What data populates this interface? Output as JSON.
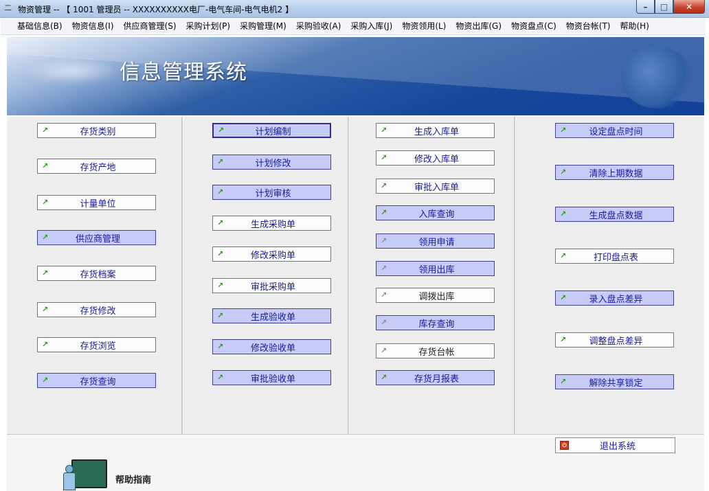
{
  "window": {
    "title": "物资管理 -- 【 1001 管理员 -- XXXXXXXXXX电厂-电气车间-电气电机2 】",
    "app_icon": "二",
    "controls": {
      "min": "–",
      "max": "□",
      "close": "✕"
    }
  },
  "menu": [
    "基础信息(B)",
    "物资信息(I)",
    "供应商管理(S)",
    "采购计划(P)",
    "采购管理(M)",
    "采购验收(A)",
    "采购入库(J)",
    "物资领用(L)",
    "物资出库(G)",
    "物资盘点(C)",
    "物资台帐(T)",
    "帮助(H)"
  ],
  "banner": {
    "system_title": "信息管理系统"
  },
  "arrow_glyph": "↗",
  "columns": {
    "col1": [
      "存货类别",
      "存货产地",
      "计量单位",
      "供应商管理",
      "存货档案",
      "存货修改",
      "存货浏览",
      "存货查询"
    ],
    "col2": [
      "计划编制",
      "计划修改",
      "计划审核",
      "生成采购单",
      "修改采购单",
      "审批采购单",
      "生成验收单",
      "修改验收单",
      "审批验收单"
    ],
    "col3": [
      "生成入库单",
      "修改入库单",
      "审批入库单",
      "入库查询",
      "领用申请",
      "领用出库",
      "调拨出库",
      "库存查询",
      "存货台帐",
      "存货月报表"
    ],
    "col4": [
      "设定盘点时间",
      "清除上期数据",
      "生成盘点数据",
      "打印盘点表",
      "录入盘点差异",
      "调整盘点差异",
      "解除共享锁定"
    ]
  },
  "bottom": {
    "exit_label": "退出系统",
    "exit_icon": "⏻",
    "help_label": "帮助指南"
  }
}
